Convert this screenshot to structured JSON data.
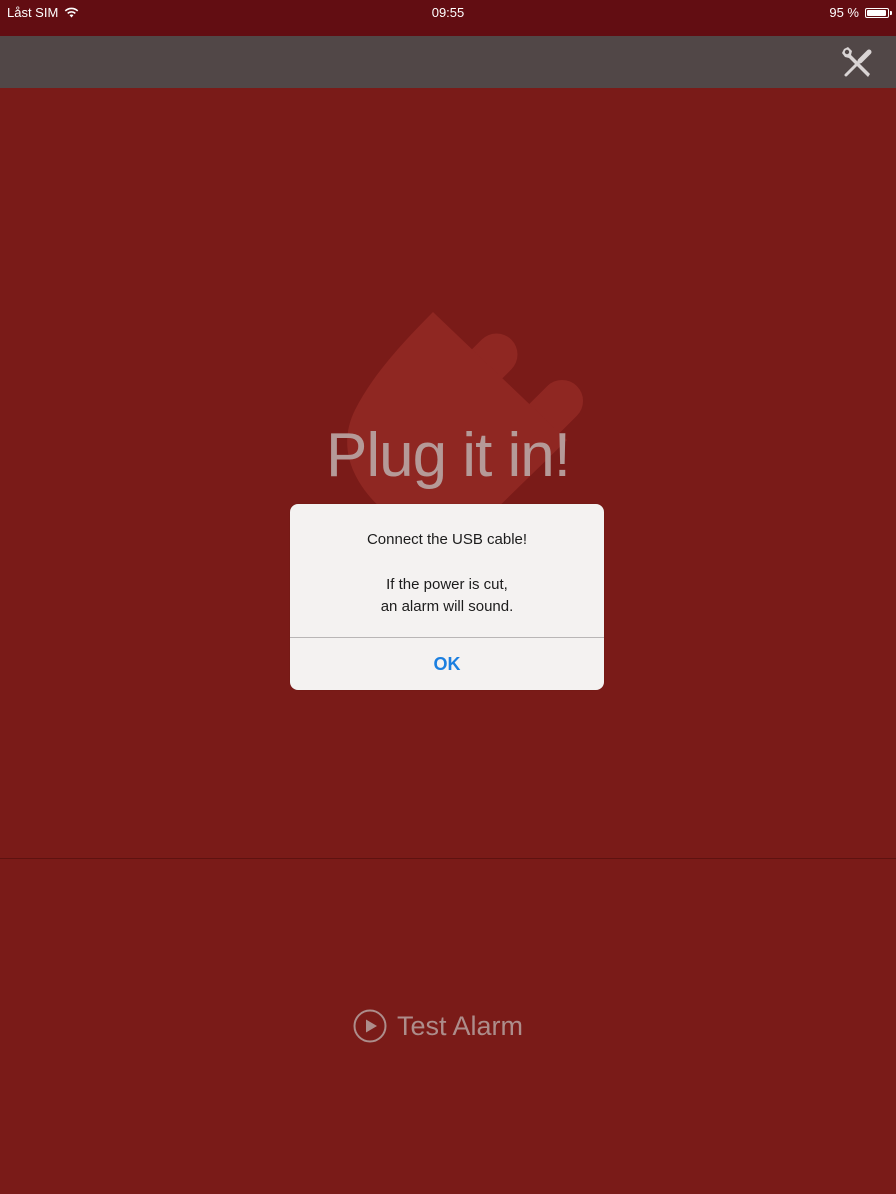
{
  "status_bar": {
    "carrier": "Låst SIM",
    "time": "09:55",
    "battery_text": "95 %",
    "battery_level": 0.95
  },
  "toolbar": {
    "settings_icon": "tools-icon"
  },
  "main": {
    "headline": "Plug it in!",
    "test_alarm_label": "Test Alarm",
    "plug_icon": "plug-icon"
  },
  "alert": {
    "title": "Connect the USB cable!",
    "message_line1": "If the power is cut,",
    "message_line2": "an alarm will sound.",
    "ok_label": "OK"
  },
  "colors": {
    "background": "#7a1b18",
    "status_bar": "#620d12",
    "toolbar": "#514747",
    "alert_button": "#1b7fe0"
  }
}
